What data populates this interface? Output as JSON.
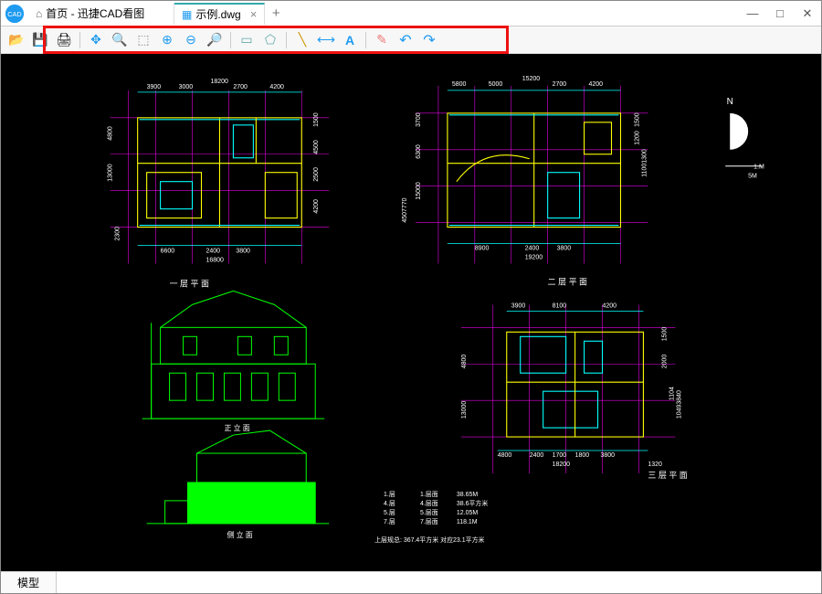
{
  "app": {
    "logo_text": "CAD"
  },
  "tabs": {
    "home_label": "首页 - 迅捷CAD看图",
    "file_label": "示例.dwg"
  },
  "window_controls": {
    "minimize": "—",
    "maximize": "□",
    "close": "✕"
  },
  "toolbar": {
    "open": "📂",
    "save": "💾",
    "print": "🖨",
    "pan": "✥",
    "zoom_extents": "🔍",
    "window_select": "⬚",
    "zoom_in": "⊕",
    "zoom_out": "⊖",
    "zoom_prev": "🔎",
    "view_2d": "▭",
    "view_3d": "⬠",
    "measure_line": "╲",
    "measure_dim": "⟷",
    "text_tool": "A",
    "erase": "✎",
    "undo": "↶",
    "redo": "↷"
  },
  "drawing": {
    "fp1": {
      "top_dims": [
        "3900",
        "3000",
        "18200",
        "2700",
        "4200"
      ],
      "left_dims": [
        "13000",
        "4800"
      ],
      "right_dims": [
        "1500",
        "4500",
        "2500",
        "4200"
      ],
      "bottom_dims": [
        "6600",
        "2400",
        "3800",
        "16800"
      ],
      "title": "一 层 平 面"
    },
    "fp2": {
      "top_dims": [
        "5800",
        "5000",
        "15200",
        "2700",
        "4200"
      ],
      "left_dims": [
        "15000",
        "6300",
        "3700"
      ],
      "right_dims": [
        "1500",
        "1200",
        "11001300"
      ],
      "bottom_dims": [
        "8900",
        "2400",
        "3800",
        "19200"
      ],
      "title": "二 层 平 面",
      "note": "4507770"
    },
    "fp3": {
      "top_dims": [
        "3900",
        "8100",
        "4200"
      ],
      "right_dims": [
        "1500",
        "2000",
        "1104",
        "10493840"
      ],
      "bottom_dims": [
        "4800",
        "2400",
        "1700",
        "1800",
        "3800",
        "18200",
        "1320"
      ],
      "left_dims": [
        "13000",
        "4800"
      ],
      "title": "三 层 平 面"
    },
    "elev1": {
      "title": "正 立 面"
    },
    "elev2": {
      "title": "侧 立 面"
    },
    "compass": {
      "n": "N",
      "scale1": "1.M",
      "scale2": "5M"
    },
    "note_block": {
      "rows": [
        [
          "1.层",
          "1.层面",
          "38.65M"
        ],
        [
          "4.层",
          "4.层面",
          "38.6平方米"
        ],
        [
          "5.层",
          "5.层面",
          "12.05M"
        ],
        [
          "7.层",
          "7.层面",
          "118.1M"
        ]
      ],
      "footer": "上层规总:   367.4平方米  对应23.1平方米"
    }
  },
  "bottom": {
    "model_tab": "模型"
  }
}
